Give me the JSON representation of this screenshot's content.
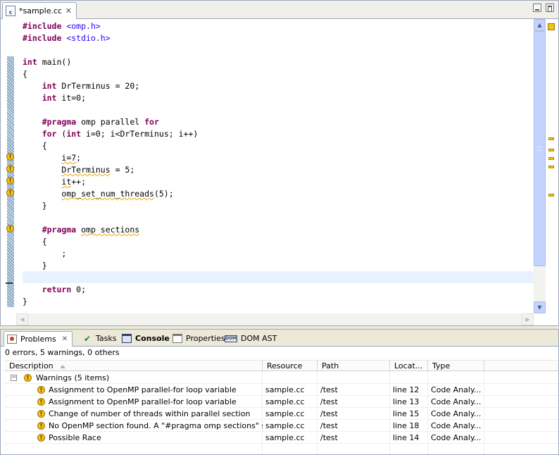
{
  "editor": {
    "tab_label": "*sample.cc",
    "file_icon_text": "c",
    "code_lines": [
      "#include <omp.h>",
      "#include <stdio.h>",
      "",
      "int main()",
      "{",
      "    int DrTerminus = 20;",
      "    int it=0;",
      "",
      "    #pragma omp parallel for",
      "    for (int i=0; i<DrTerminus; i++)",
      "    {",
      "        i=7;",
      "        DrTerminus = 5;",
      "        it++;",
      "        omp_set_num_threads(5);",
      "    }",
      "",
      "    #pragma omp sections",
      "    {",
      "        ;",
      "    }",
      "",
      "    return 0;",
      "}"
    ],
    "warning_markers_on_lines": [
      12,
      13,
      14,
      15,
      18
    ],
    "current_line": 22
  },
  "panel": {
    "tabs": [
      {
        "label": "Problems",
        "icon": "problems-icon",
        "active": true
      },
      {
        "label": "Tasks",
        "icon": "tasks-icon"
      },
      {
        "label": "Console",
        "icon": "console-icon"
      },
      {
        "label": "Properties",
        "icon": "properties-icon"
      },
      {
        "label": "DOM AST",
        "icon": "dom-ast-icon"
      }
    ],
    "summary": "0 errors, 5 warnings, 0 others",
    "columns": [
      "Description",
      "Resource",
      "Path",
      "Locat...",
      "Type"
    ],
    "group_label": "Warnings (5 items)",
    "rows": [
      {
        "description": "Assignment to OpenMP parallel-for loop variable",
        "resource": "sample.cc",
        "path": "/test",
        "location": "line 12",
        "type": "Code Analy..."
      },
      {
        "description": "Assignment to OpenMP parallel-for loop variable",
        "resource": "sample.cc",
        "path": "/test",
        "location": "line 13",
        "type": "Code Analy..."
      },
      {
        "description": "Change of number of threads within parallel section",
        "resource": "sample.cc",
        "path": "/test",
        "location": "line 15",
        "type": "Code Analy..."
      },
      {
        "description": "No OpenMP section found. A \"#pragma omp sections\" should c",
        "resource": "sample.cc",
        "path": "/test",
        "location": "line 18",
        "type": "Code Analy..."
      },
      {
        "description": "Possible Race",
        "resource": "sample.cc",
        "path": "/test",
        "location": "line 14",
        "type": "Code Analy..."
      }
    ]
  },
  "colors": {
    "keyword": "#7f0055",
    "string": "#2a00ff",
    "warning": "#f2c11a",
    "current_line": "#e8f2fe"
  }
}
